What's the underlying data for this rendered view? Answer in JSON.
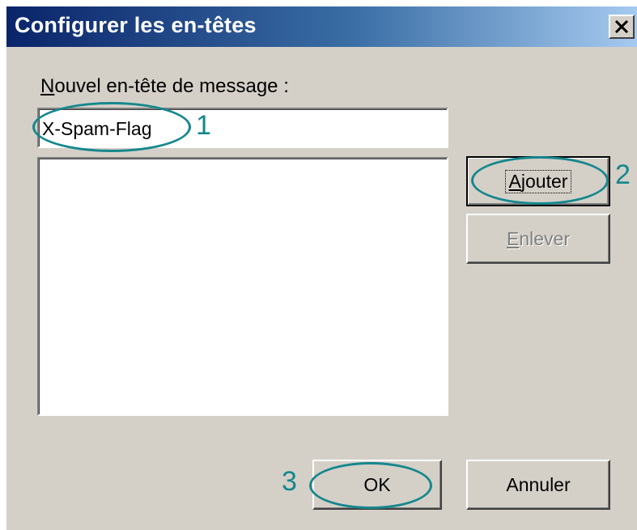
{
  "window": {
    "title": "Configurer les en-têtes",
    "close_glyph": "✕"
  },
  "form": {
    "label_access_key": "N",
    "label_rest": "ouvel en-tête de message :",
    "input_value": "X-Spam-Flag"
  },
  "buttons": {
    "add_access_key": "A",
    "add_rest": "jouter",
    "remove_access_key": "E",
    "remove_rest": "nlever",
    "ok": "OK",
    "cancel": "Annuler"
  },
  "annotations": {
    "step1": "1",
    "step2": "2",
    "step3": "3",
    "color": "#15878d"
  },
  "colors": {
    "dialog_bg": "#d4d0c8",
    "title_gradient_start": "#0a246a",
    "title_gradient_end": "#a6caf0"
  }
}
